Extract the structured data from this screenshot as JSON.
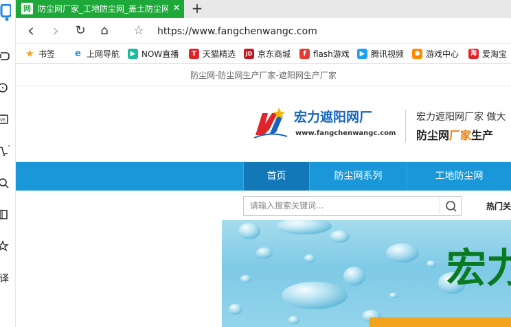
{
  "sidebar": {
    "icons": [
      "browser-logo-icon",
      "game-icon",
      "chat-icon",
      "live-icon",
      "cart-icon",
      "search-icon",
      "book-icon",
      "star-icon",
      "translate-icon"
    ]
  },
  "tab": {
    "favicon": "网",
    "title": "防尘网厂家_工地防尘网_盖土防尘网",
    "close": "✕",
    "new_tab": "+"
  },
  "navbar": {
    "back": "‹",
    "forward": "›",
    "reload": "↻",
    "home": "⌂",
    "favorite": "☆",
    "url": "https://www.fangchenwangc.com"
  },
  "bookmarks": [
    {
      "label": "书签",
      "icon": "★",
      "color": "#f5a623"
    },
    {
      "label": "上网导航",
      "icon": "e",
      "color": "#1e88e5"
    },
    {
      "label": "NOW直播",
      "icon": "▶",
      "color": "#1abc9c"
    },
    {
      "label": "天猫精选",
      "icon": "T",
      "color": "#e0242b"
    },
    {
      "label": "京东商城",
      "icon": "JD",
      "color": "#c4161c"
    },
    {
      "label": "flash游戏",
      "icon": "f",
      "color": "#e53935"
    },
    {
      "label": "腾讯视频",
      "icon": "▶",
      "color": "#1ea0f0"
    },
    {
      "label": "游戏中心",
      "icon": "●",
      "color": "#ff8a00"
    },
    {
      "label": "爱淘宝",
      "icon": "淘",
      "color": "#e0242b"
    }
  ],
  "page": {
    "tagline": "防尘网-防尘网生产厂家-遮阳网生产厂家",
    "logo": {
      "title": "宏力遮阳网厂",
      "url": "www.fangchenwangc.com"
    },
    "header": {
      "slogan": "宏力遮阳网厂家 做大",
      "products_prefix": "防尘网",
      "products_highlight": "厂家",
      "products_suffix": "生产"
    },
    "nav": [
      {
        "label": "首页"
      },
      {
        "label": "防尘网系列"
      },
      {
        "label": "工地防尘网"
      }
    ],
    "search": {
      "placeholder": "请输入搜索关键词..."
    },
    "hot": "热门关",
    "banner": {
      "text": "宏力"
    }
  }
}
